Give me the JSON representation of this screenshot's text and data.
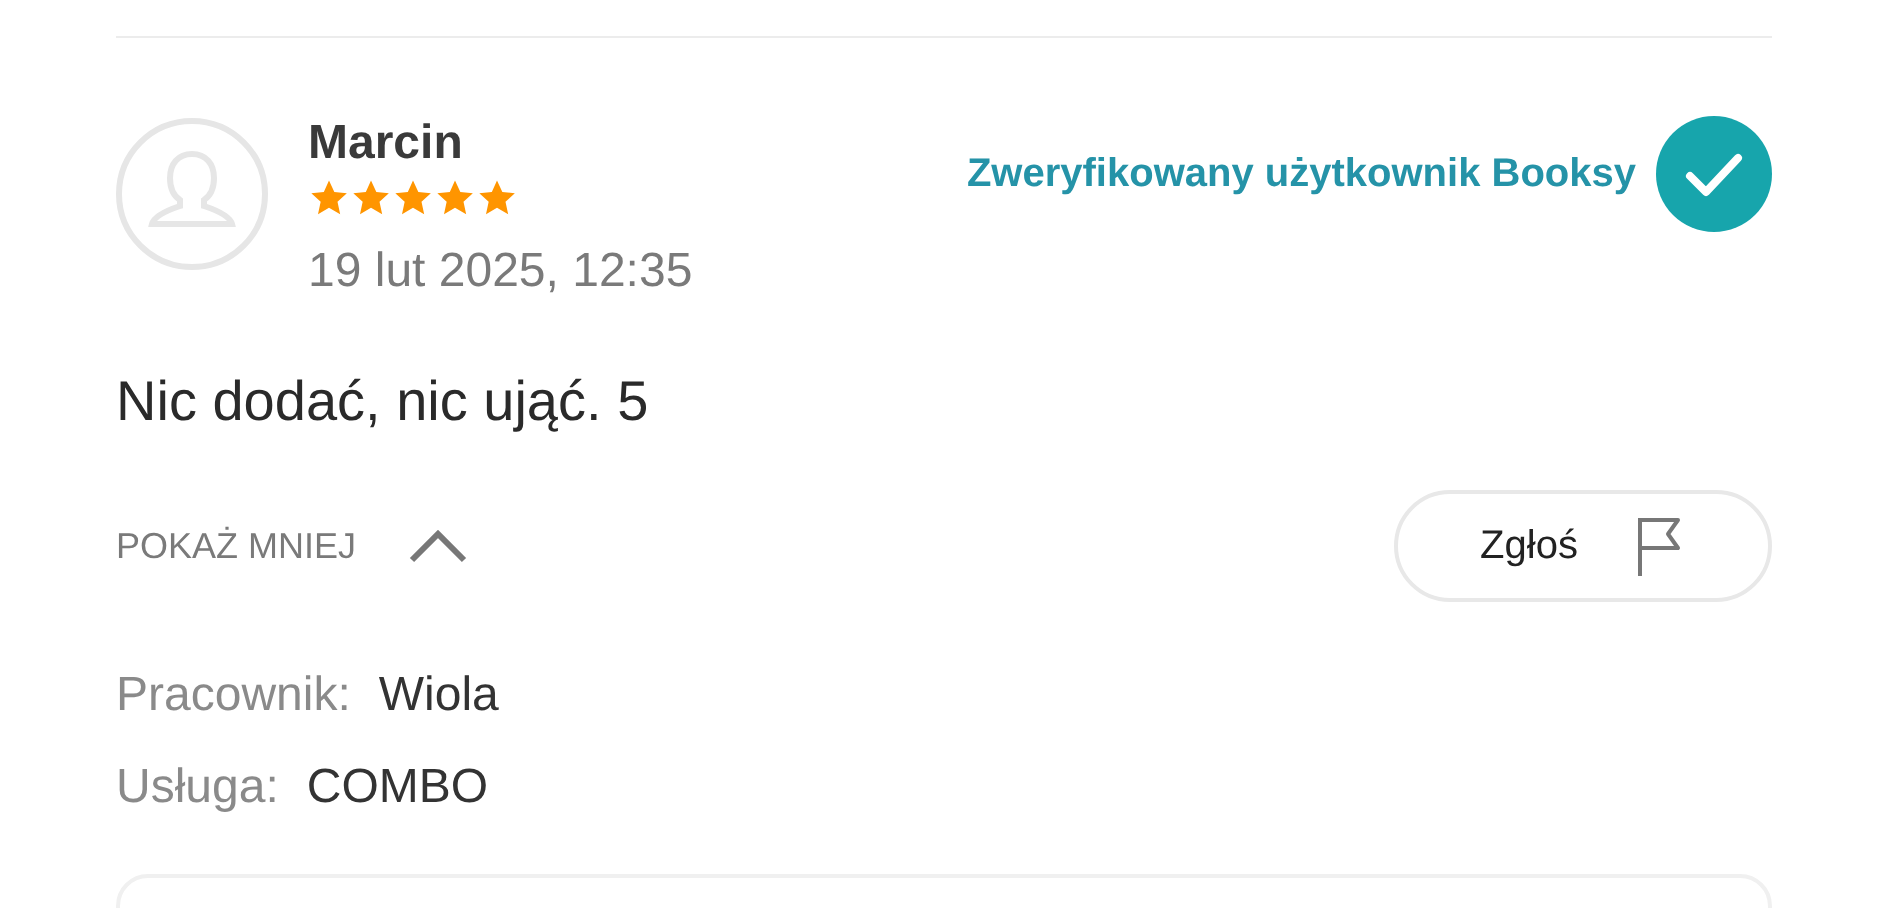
{
  "review": {
    "author": "Marcin",
    "stars": 5,
    "date": "19 lut 2025, 12:35",
    "verified_label": "Zweryfikowany użytkownik Booksy",
    "text": "Nic dodać, nic ująć. 5",
    "toggle": {
      "label": "POKAŻ MNIEJ",
      "expanded": true
    },
    "report_button": "Zgłoś",
    "details": [
      {
        "label": "Pracownik:",
        "value": "Wiola"
      },
      {
        "label": "Usługa:",
        "value": "COMBO"
      }
    ]
  }
}
